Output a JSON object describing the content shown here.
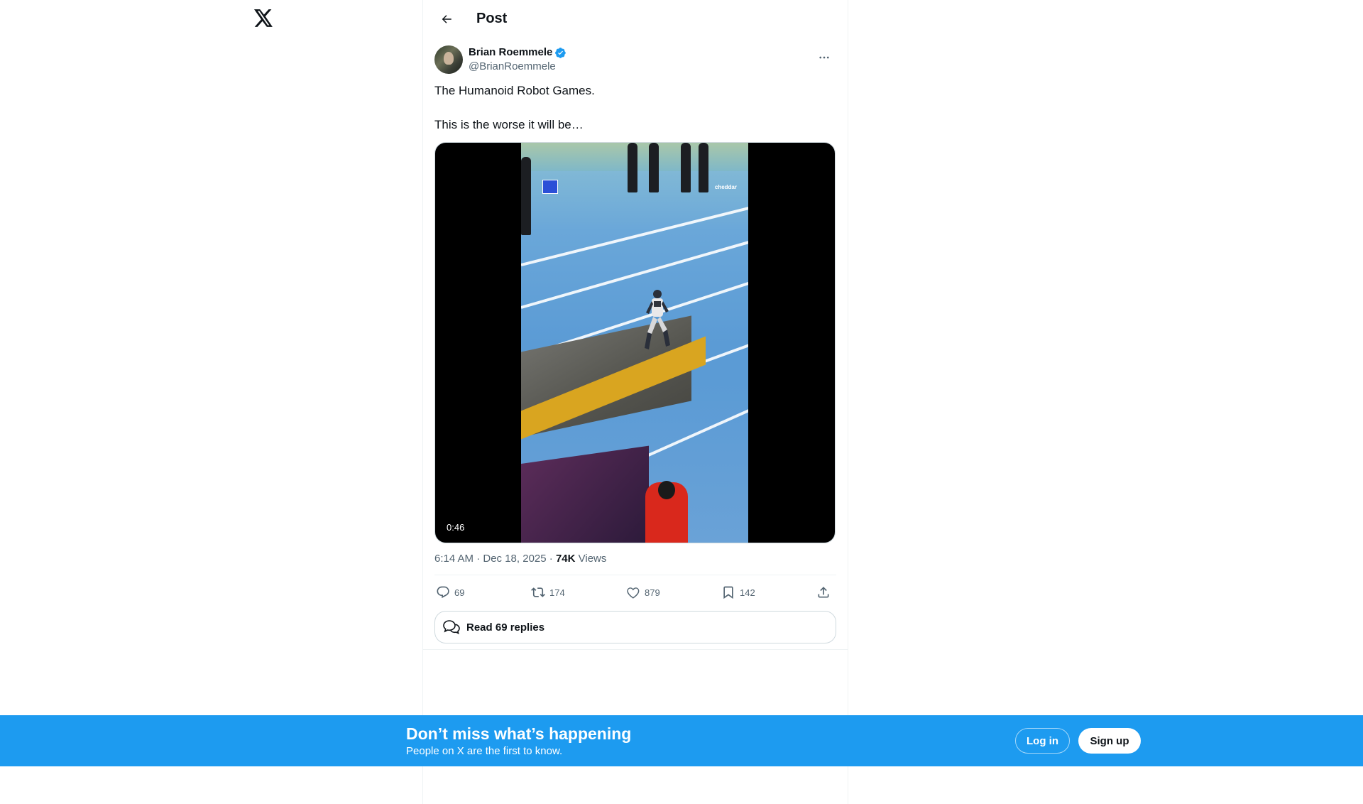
{
  "nav": {
    "logo": "x-logo"
  },
  "header": {
    "title": "Post"
  },
  "post": {
    "author": {
      "display_name": "Brian Roemmele",
      "handle": "@BrianRoemmele",
      "verified": true
    },
    "text": "The Humanoid Robot Games.\n\nThis is the worse it will be…",
    "media": {
      "type": "video",
      "duration": "0:46",
      "watermark": "cheddar"
    },
    "timestamp": "6:14 AM · Dec 18, 2025 · ",
    "views_count": "74K",
    "views_label": " Views",
    "stats": {
      "replies": "69",
      "reposts": "174",
      "likes": "879",
      "bookmarks": "142"
    },
    "read_replies_label": "Read 69 replies"
  },
  "banner": {
    "title": "Don’t miss what’s happening",
    "subtitle": "People on X are the first to know.",
    "login_label": "Log in",
    "signup_label": "Sign up"
  },
  "colors": {
    "accent": "#1d9bf0",
    "text_primary": "#0f1419",
    "text_secondary": "#536471",
    "border": "#eff3f4"
  }
}
